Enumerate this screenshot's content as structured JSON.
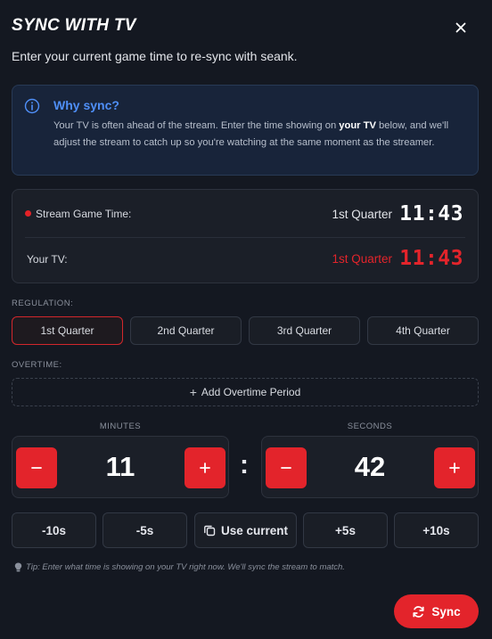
{
  "header": {
    "title": "SYNC WITH TV",
    "subtitle": "Enter your current game time to re-sync with seank."
  },
  "info": {
    "heading": "Why sync?",
    "text_before": "Your TV is often ahead of the stream. Enter the time showing on ",
    "text_bold": "your TV",
    "text_after": " below, and we'll adjust the stream to catch up so you're watching at the same moment as the streamer."
  },
  "status": {
    "stream": {
      "label": "Stream Game Time:",
      "quarter": "1st Quarter",
      "time": "11:43"
    },
    "tv": {
      "label": "Your TV:",
      "quarter": "1st Quarter",
      "time": "11:43"
    }
  },
  "regulation": {
    "label": "REGULATION:",
    "quarters": [
      "1st Quarter",
      "2nd Quarter",
      "3rd Quarter",
      "4th Quarter"
    ],
    "selected": "1st Quarter"
  },
  "overtime": {
    "label": "OVERTIME:",
    "add_label": "Add Overtime Period"
  },
  "minutes": {
    "label": "MINUTES",
    "value": "11",
    "minus": "−",
    "plus": "+"
  },
  "seconds": {
    "label": "SECONDS",
    "value": "42",
    "minus": "−",
    "plus": "+"
  },
  "separator": ":",
  "quick": {
    "minus10": "-10s",
    "minus5": "-5s",
    "use_current": "Use current",
    "plus5": "+5s",
    "plus10": "+10s"
  },
  "tip": "Tip: Enter what time is showing on your TV right now. We'll sync the stream to match.",
  "sync_label": "Sync",
  "colors": {
    "accent": "#e3242b",
    "info": "#4f8ff7",
    "bg": "#141821"
  },
  "icons": [
    "close-icon",
    "info-icon",
    "plus-icon",
    "minus-icon",
    "copy-icon",
    "lightbulb-icon",
    "sync-icon"
  ]
}
